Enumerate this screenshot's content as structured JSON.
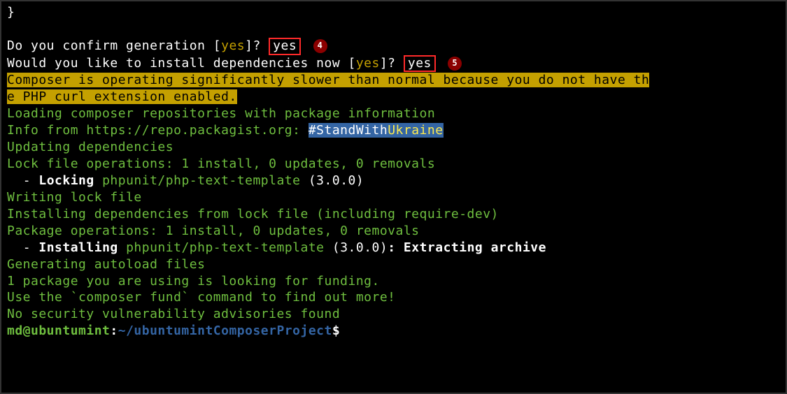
{
  "lines": {
    "brace": "}",
    "confirm_prompt_pre": "Do you confirm generation [",
    "confirm_prompt_yes": "yes",
    "confirm_prompt_post": "]? ",
    "confirm_input": "yes",
    "badge4": "4",
    "install_prompt_pre": "Would you like to install dependencies now [",
    "install_prompt_yes": "yes",
    "install_prompt_post": "]? ",
    "install_input": "yes",
    "badge5": "5",
    "warn1": "Composer is operating significantly slower than normal because you do not have th",
    "warn2": "e PHP curl extension enabled.",
    "loading": "Loading composer repositories with package information",
    "info_pre": "Info from https://repo.packagist.org: ",
    "stand1": "#StandWith",
    "stand2": "Ukraine",
    "updating": "Updating dependencies",
    "lockops": "Lock file operations: 1 install, 0 updates, 0 removals",
    "locking_dash": "  - ",
    "locking_label": "Locking",
    "locking_pkg": " phpunit/php-text-template ",
    "locking_ver": "(3.0.0)",
    "writing": "Writing lock file",
    "instdeps": "Installing dependencies from lock file (including require-dev)",
    "pkgops": "Package operations: 1 install, 0 updates, 0 removals",
    "inst_dash": "  - ",
    "inst_label": "Installing",
    "inst_pkg": " phpunit/php-text-template ",
    "inst_ver": "(3.0.0)",
    "inst_extract": ": Extracting archive",
    "autoload": "Generating autoload files",
    "funding1": "1 package you are using is looking for funding.",
    "funding2": "Use the `composer fund` command to find out more!",
    "nosec": "No security vulnerability advisories found",
    "prompt_user": "md@ubuntumint",
    "prompt_sep": ":",
    "prompt_path": "~/ubuntumintComposerProject",
    "prompt_end": "$"
  }
}
